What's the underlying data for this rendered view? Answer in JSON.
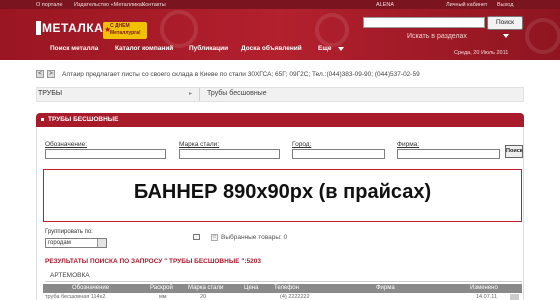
{
  "topbar": {
    "links": [
      "О портале",
      "Издательство «Металлика»",
      "Контакты"
    ],
    "user": "ALENA",
    "cabinet": "Личный кабинет",
    "exit": "Выход"
  },
  "header": {
    "logo": "МЕТАЛ",
    "logo_suffix": "КА",
    "promo_line1": "С ДНЕМ",
    "promo_line2": "Металлурга!",
    "search_button": "Поиск",
    "search_hint": "Искать в разделах",
    "date": "Среда, 20 Июль 2011",
    "nav": [
      "Поиск металла",
      "Каталог компаний",
      "Публикации",
      "Доска объявлений",
      "Еще"
    ]
  },
  "ticker": {
    "prev": "<",
    "next": ">",
    "text": "Алтаир предлагает листы со своего склада в Киеве по стали 30ХГСА; 65Г; 09Г2С; Тел.:(044)383-09-90; (044)537-02-59"
  },
  "breadcrumbs": [
    "ТРУБЫ",
    "Трубы бесшовные"
  ],
  "panel": {
    "title": "ТРУБЫ БЕСШОВНЫЕ"
  },
  "filters": {
    "labels": [
      "Обозначение:",
      "Марка стали:",
      "Город:",
      "Фирма:"
    ],
    "find_button": "Поиск"
  },
  "banner": "БАННЕР 890х90px (в прайсах)",
  "grouping": {
    "label": "Группировать по:",
    "value": "городам"
  },
  "selected_items": "Выбранные товары: 0",
  "results": {
    "title": "РЕЗУЛЬТАТЫ ПОИСКА ПО ЗАПРОСУ \" ТРУБЫ БЕСШОВНЫЕ \":5203",
    "region": "АРТЕМОВКА",
    "columns": [
      "Обозначение",
      "Раскрой",
      "Марка стали",
      "Цена",
      "Телефон",
      "Фирма",
      "Изменено"
    ],
    "row_partial": [
      "труба бесшовная 114х2",
      "мм",
      "20",
      "",
      "(4) 2222222",
      "",
      "14.07.11"
    ]
  },
  "colors": {
    "brand": "#b01e2c",
    "topbar": "#7a1520",
    "result_title": "#b0172a",
    "promo": "#f2c200"
  }
}
